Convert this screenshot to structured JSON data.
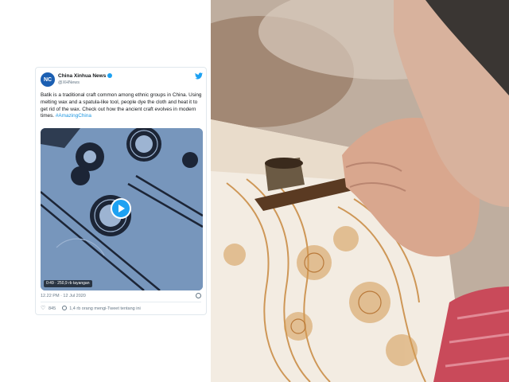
{
  "tweet": {
    "account_name": "China Xinhua News",
    "account_handle": "@XHNews",
    "avatar_text": "NC",
    "text": "Batik is a traditional craft common among ethnic groups in China. Using melting wax and a spatula-like tool, people dye the cloth and heat it to get rid of the wax. Check out how the ancient craft evolves in modern times.",
    "hashtag": "#AmazingChina",
    "video_meta": "0:49 · 250,9 rb tayangan",
    "timestamp": "12.22 PM · 12 Jul 2020",
    "like_count": "845",
    "footer_text": "1,4 rb orang mengi-Tweet tentang ini"
  },
  "icons": [
    "verified-icon",
    "twitter-icon",
    "play-icon",
    "info-icon",
    "heart-icon",
    "person-icon"
  ],
  "colors": {
    "twitter_blue": "#1da1f2",
    "hashtag": "#1b95e0",
    "avatar": "#1b5fb2"
  }
}
